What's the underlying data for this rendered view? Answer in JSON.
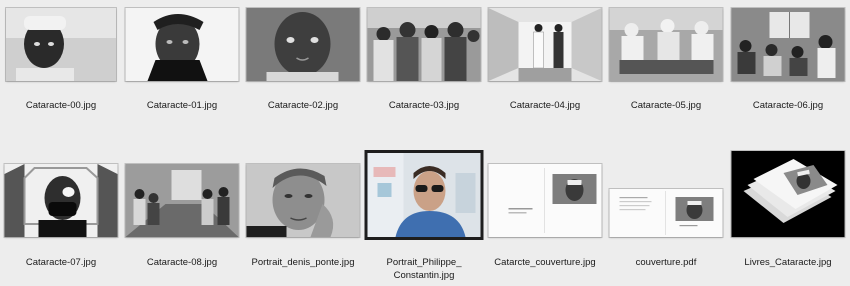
{
  "files": [
    {
      "name": "Cataracte-00.jpg",
      "icon": "bw-photo-child-portrait"
    },
    {
      "name": "Cataracte-01.jpg",
      "icon": "bw-photo-woman-headwrap"
    },
    {
      "name": "Cataracte-02.jpg",
      "icon": "bw-photo-girl-portrait"
    },
    {
      "name": "Cataracte-03.jpg",
      "icon": "bw-photo-crowd"
    },
    {
      "name": "Cataracte-04.jpg",
      "icon": "bw-photo-hallway-people"
    },
    {
      "name": "Cataracte-05.jpg",
      "icon": "bw-photo-surgery-room"
    },
    {
      "name": "Cataracte-06.jpg",
      "icon": "bw-photo-waiting-room"
    },
    {
      "name": "Cataracte-07.jpg",
      "icon": "bw-photo-man-eye-patch"
    },
    {
      "name": "Cataracte-08.jpg",
      "icon": "bw-photo-corridor-patients"
    },
    {
      "name": "Portrait_denis_ponte.jpg",
      "icon": "bw-photo-man-portrait"
    },
    {
      "name": "Portrait_Philippe_\nConstantin.jpg",
      "icon": "color-photo-man-sunglasses",
      "selected": true
    },
    {
      "name": "Catarcte_couverture.jpg",
      "icon": "book-spread-cover"
    },
    {
      "name": "couverture.pdf",
      "icon": "pdf-cover-spread"
    },
    {
      "name": "Livres_Cataracte.jpg",
      "icon": "stacked-books-photo"
    }
  ]
}
